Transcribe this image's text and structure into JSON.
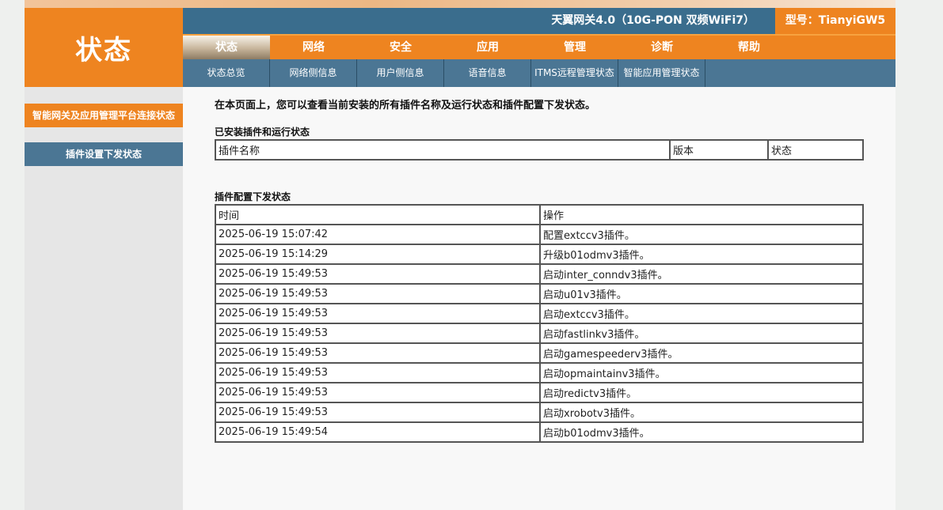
{
  "header": {
    "logo_text": "状态",
    "device_title": "天翼网关4.0（10G-PON 双频WiFi7）",
    "model": "型号：TianyiGW5"
  },
  "main_nav": [
    {
      "label": "状态",
      "active": true
    },
    {
      "label": "网络"
    },
    {
      "label": "安全"
    },
    {
      "label": "应用"
    },
    {
      "label": "管理"
    },
    {
      "label": "诊断"
    },
    {
      "label": "帮助"
    }
  ],
  "sub_nav": [
    {
      "label": "状态总览"
    },
    {
      "label": "网络侧信息"
    },
    {
      "label": "用户侧信息"
    },
    {
      "label": "语音信息"
    },
    {
      "label": "ITMS远程管理状态"
    },
    {
      "label": "智能应用管理状态"
    }
  ],
  "sidebar": {
    "items": [
      {
        "label": "智能网关及应用管理平台连接状态"
      },
      {
        "label": "插件设置下发状态"
      }
    ]
  },
  "content": {
    "intro": "在本页面上，您可以查看当前安装的所有插件名称及运行状态和插件配置下发状态。",
    "plugins_title": "已安装插件和运行状态",
    "plugins_headers": [
      "插件名称",
      "版本",
      "状态"
    ],
    "config_title": "插件配置下发状态",
    "config_headers": [
      "时间",
      "操作"
    ],
    "config_rows": [
      {
        "time": "2025-06-19 15:07:42",
        "op": "配置extccv3插件。"
      },
      {
        "time": "2025-06-19 15:14:29",
        "op": "升级b01odmv3插件。"
      },
      {
        "time": "2025-06-19 15:49:53",
        "op": "启动inter_conndv3插件。"
      },
      {
        "time": "2025-06-19 15:49:53",
        "op": "启动u01v3插件。"
      },
      {
        "time": "2025-06-19 15:49:53",
        "op": "启动extccv3插件。"
      },
      {
        "time": "2025-06-19 15:49:53",
        "op": "启动fastlinkv3插件。"
      },
      {
        "time": "2025-06-19 15:49:53",
        "op": "启动gamespeederv3插件。"
      },
      {
        "time": "2025-06-19 15:49:53",
        "op": "启动opmaintainv3插件。"
      },
      {
        "time": "2025-06-19 15:49:53",
        "op": "启动redictv3插件。"
      },
      {
        "time": "2025-06-19 15:49:53",
        "op": "启动xrobotv3插件。"
      },
      {
        "time": "2025-06-19 15:49:54",
        "op": "启动b01odmv3插件。"
      }
    ]
  },
  "colors": {
    "orange": "#ee8420",
    "blue": "#3a6d8d",
    "sub_blue": "#4b7694"
  }
}
